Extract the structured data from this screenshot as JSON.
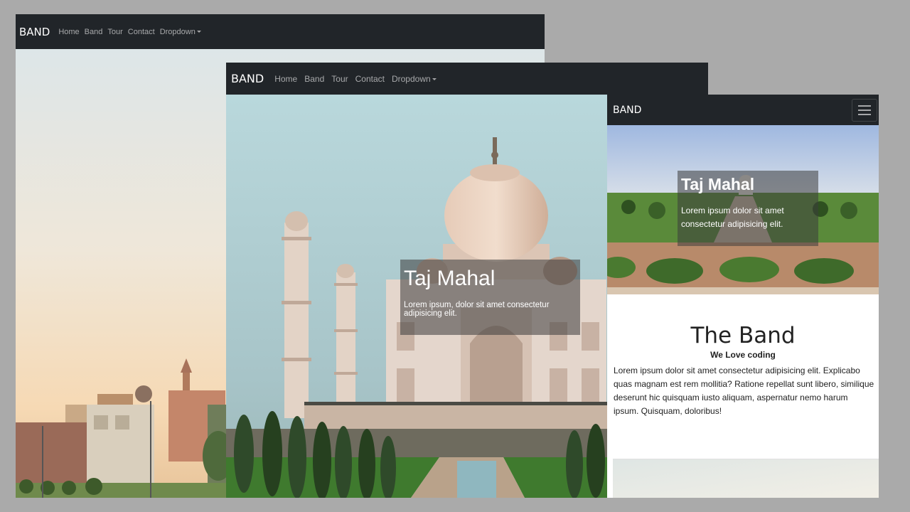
{
  "desktop": {
    "brand": "BAND",
    "nav": [
      "Home",
      "Band",
      "Tour",
      "Contact",
      "Dropdown"
    ]
  },
  "tablet": {
    "brand": "BAND",
    "nav": [
      "Home",
      "Band",
      "Tour",
      "Contact",
      "Dropdown"
    ],
    "caption": {
      "title": "Taj Mahal",
      "text": "Lorem ipsum, dolor sit amet consectetur adipisicing elit."
    }
  },
  "mobile": {
    "brand": "BAND",
    "menu_icon": "hamburger-icon",
    "caption": {
      "title": "Taj Mahal",
      "text": "Lorem ipsum dolor sit amet consectetur adipisicing elit."
    },
    "band_section": {
      "title": "The Band",
      "subtitle": "We Love coding",
      "text": "Lorem ipsum dolor sit amet consectetur adipisicing elit. Explicabo quas magnam est rem mollitia? Ratione repellat sunt libero, similique deserunt hic quisquam iusto aliquam, aspernatur nemo harum ipsum. Quisquam, doloribus!"
    }
  },
  "colors": {
    "navbar": "#212529",
    "background": "#aaaaaa"
  }
}
